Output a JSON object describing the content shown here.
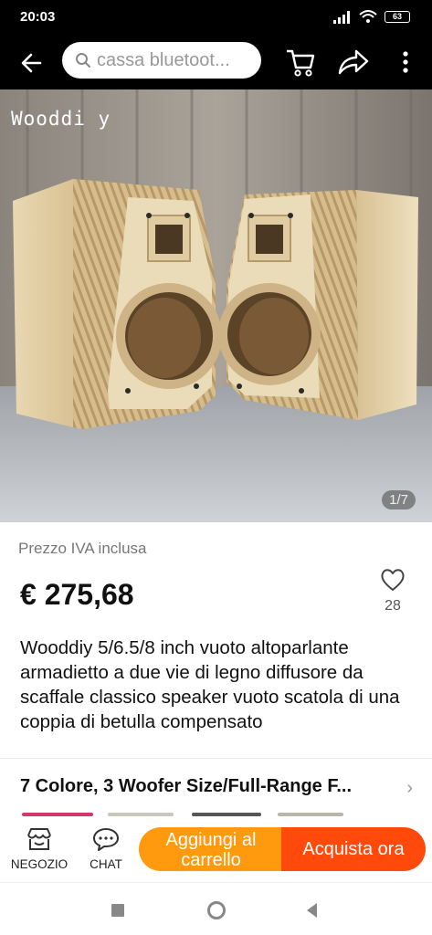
{
  "status": {
    "time": "20:03",
    "battery": "63"
  },
  "search": {
    "placeholder": "cassa bluetoot..."
  },
  "image": {
    "watermark": "Wooddi y",
    "counter": "1/7"
  },
  "product": {
    "price_note": "Prezzo IVA inclusa",
    "price": "€ 275,68",
    "wish_count": "28",
    "title": "Wooddiy 5/6.5/8 inch vuoto altoparlante armadietto a due vie di legno diffusore da scaffale classico speaker vuoto scatola di una coppia di betulla compensato",
    "variant": "7 Colore, 3 Woofer Size/Full-Range F..."
  },
  "actions": {
    "shop_label": "NEGOZIO",
    "chat_label": "CHAT",
    "add_to_cart": "Aggiungi al carrello",
    "buy_now": "Acquista ora"
  },
  "icons": {
    "back": "arrow-left-icon",
    "search": "search-icon",
    "cart": "cart-icon",
    "share": "share-icon",
    "more": "more-vertical-icon",
    "wish": "heart-icon",
    "shop": "store-icon",
    "chat": "chat-bubble-icon"
  },
  "colors": {
    "add_to_cart": "#ff9a0f",
    "buy_now": "#ff4a0c",
    "top_bar": "#000000"
  }
}
